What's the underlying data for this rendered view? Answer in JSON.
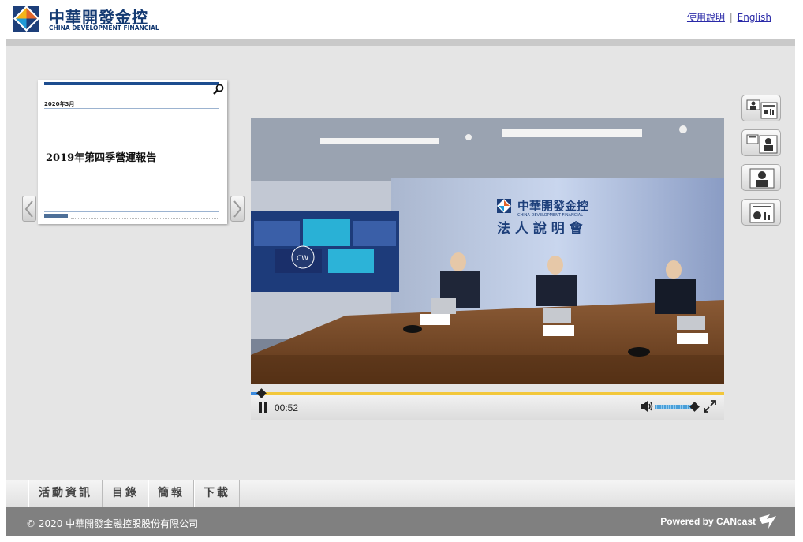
{
  "header": {
    "logo_zh": "中華開發金控",
    "logo_en": "CHINA DEVELOPMENT FINANCIAL",
    "links": [
      {
        "label": "使用說明"
      },
      {
        "label": "English"
      }
    ],
    "separator": "|"
  },
  "slide": {
    "date": "2020年3月",
    "title": "2019年第四季營運報告",
    "footer_brand": "中華開發金控"
  },
  "video": {
    "backdrop_logo_zh": "中華開發金控",
    "backdrop_logo_en": "CHINA DEVELOPMENT FINANCIAL",
    "backdrop_title": "法 人 說 明 會",
    "tile_label": "CW",
    "progress": 0.02,
    "volume": 0.9
  },
  "controls": {
    "time": "00:52"
  },
  "tabs": [
    {
      "label": "活動資訊"
    },
    {
      "label": "目錄"
    },
    {
      "label": "簡報"
    },
    {
      "label": "下載"
    }
  ],
  "footer": {
    "copyright": "© 2020 中華開發金融控股股份有限公司",
    "powered": "Powered by CANcast"
  },
  "colors": {
    "brand_blue": "#143a72",
    "progress": "#f2c73b",
    "progress_fill": "#3a8be0"
  }
}
